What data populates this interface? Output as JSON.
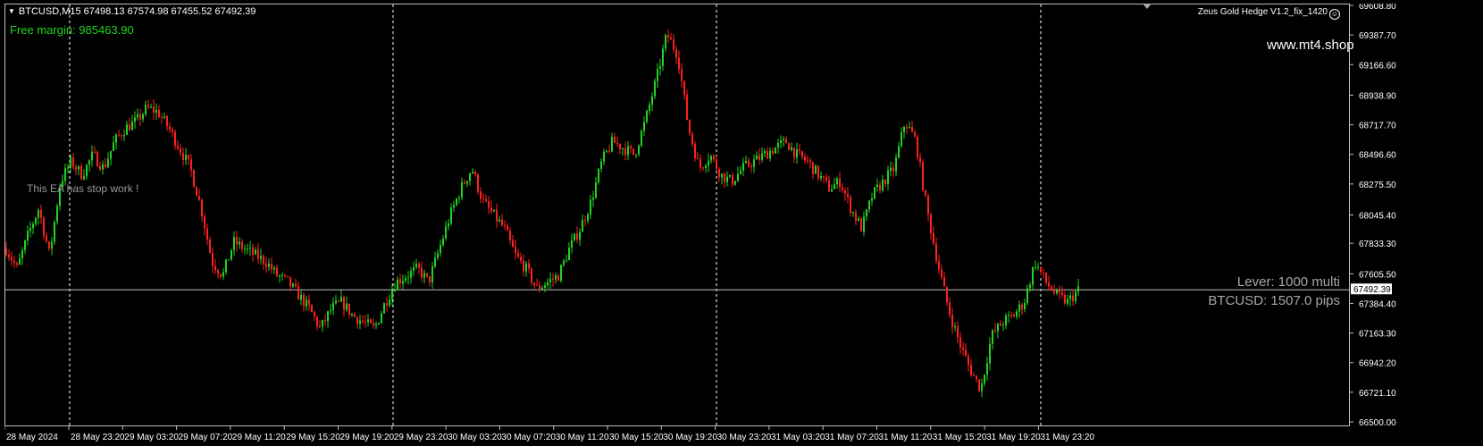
{
  "header": {
    "symbol": "BTCUSD,M15",
    "ohlc": "67498.13 67574.98 67455.52 67492.39"
  },
  "free_margin": "Free margin: 985463.90",
  "ea_title": "Zeus Gold Hedge V1.2_fix_1420",
  "ea_icon": "smiley-icon",
  "website": "www.mt4.shop",
  "stop_message": "This EA has stop work !",
  "lever_text": "Lever: 1000 multi",
  "pips_text": "BTCUSD: 1507.0 pips",
  "colors": {
    "bull": "#22d322",
    "bear": "#ff2020",
    "background": "#000000",
    "grid": "#ffffff",
    "bid_line": "#c0c0c0"
  },
  "chart_data": {
    "type": "candlestick",
    "symbol": "BTCUSD",
    "timeframe": "M15",
    "current_price": "67492.39",
    "ylim": [
      66500.0,
      69608.8
    ],
    "price_ticks": [
      "69608.80",
      "69387.70",
      "69166.60",
      "68938.90",
      "68717.70",
      "68496.60",
      "68275.50",
      "68045.40",
      "67833.30",
      "67605.50",
      "67384.40",
      "67163.30",
      "66942.20",
      "66721.10",
      "66500.00"
    ],
    "time_labels": [
      "28 May 2024",
      "28 May 23:20",
      "29 May 03:20",
      "29 May 07:20",
      "29 May 11:20",
      "29 May 15:20",
      "29 May 19:20",
      "29 May 23:20",
      "30 May 03:20",
      "30 May 07:20",
      "30 May 11:20",
      "30 May 15:20",
      "30 May 19:20",
      "30 May 23:20",
      "31 May 03:20",
      "31 May 07:20",
      "31 May 11:20",
      "31 May 15:20",
      "31 May 19:20",
      "31 May 23:20"
    ],
    "day_separators_at": [
      "29 May 00:00",
      "30 May 00:00",
      "31 May 00:00",
      "1 Jun 00:00"
    ],
    "close_path": [
      67800,
      67650,
      67900,
      68100,
      67750,
      68300,
      68450,
      68350,
      68500,
      68400,
      68600,
      68700,
      68750,
      68850,
      68820,
      68700,
      68550,
      68400,
      68100,
      67700,
      67600,
      67850,
      67800,
      67750,
      67700,
      67600,
      67550,
      67450,
      67350,
      67200,
      67350,
      67400,
      67300,
      67250,
      67200,
      67400,
      67550,
      67600,
      67650,
      67550,
      67800,
      68050,
      68250,
      68400,
      68150,
      68050,
      67950,
      67750,
      67650,
      67500,
      67550,
      67600,
      67800,
      67950,
      68150,
      68450,
      68600,
      68550,
      68500,
      68750,
      69050,
      69400,
      69250,
      68700,
      68400,
      68500,
      68350,
      68300,
      68400,
      68450,
      68500,
      68550,
      68600,
      68500,
      68450,
      68350,
      68250,
      68300,
      68100,
      67950,
      68200,
      68300,
      68400,
      68750,
      68600,
      68100,
      67700,
      67350,
      67100,
      66900,
      66750,
      67150,
      67250,
      67300,
      67400,
      67700,
      67550,
      67450,
      67400,
      67492
    ]
  }
}
